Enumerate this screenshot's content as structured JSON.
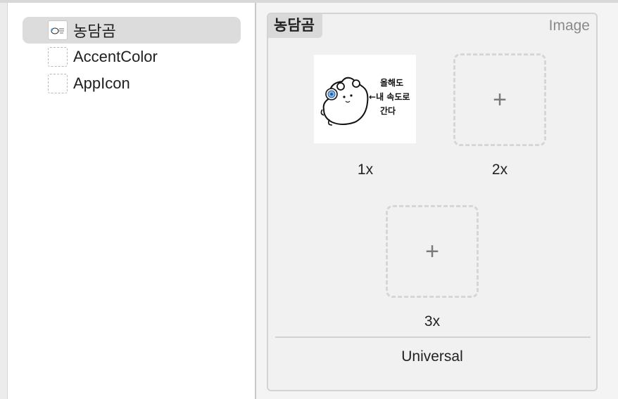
{
  "sidebar": {
    "items": [
      {
        "label": "농담곰",
        "thumb": "image-thumbnail-icon",
        "selected": true
      },
      {
        "label": "AccentColor",
        "thumb": "color-set-placeholder-icon",
        "selected": false
      },
      {
        "label": "AppIcon",
        "thumb": "app-icon-placeholder-icon",
        "selected": false
      }
    ]
  },
  "detail": {
    "set_name": "농담곰",
    "set_type": "Image",
    "slots": [
      {
        "label": "1x",
        "filled": true
      },
      {
        "label": "2x",
        "filled": false
      },
      {
        "label": "3x",
        "filled": false
      }
    ],
    "plus_glyph": "+",
    "idiom": "Universal"
  },
  "artwork": {
    "lines": [
      "올해도",
      "내 속도로",
      "간다"
    ],
    "arrow": "←"
  },
  "colors": {
    "selection": "#dcdcdc",
    "accent_ring": "#4a90d9"
  }
}
